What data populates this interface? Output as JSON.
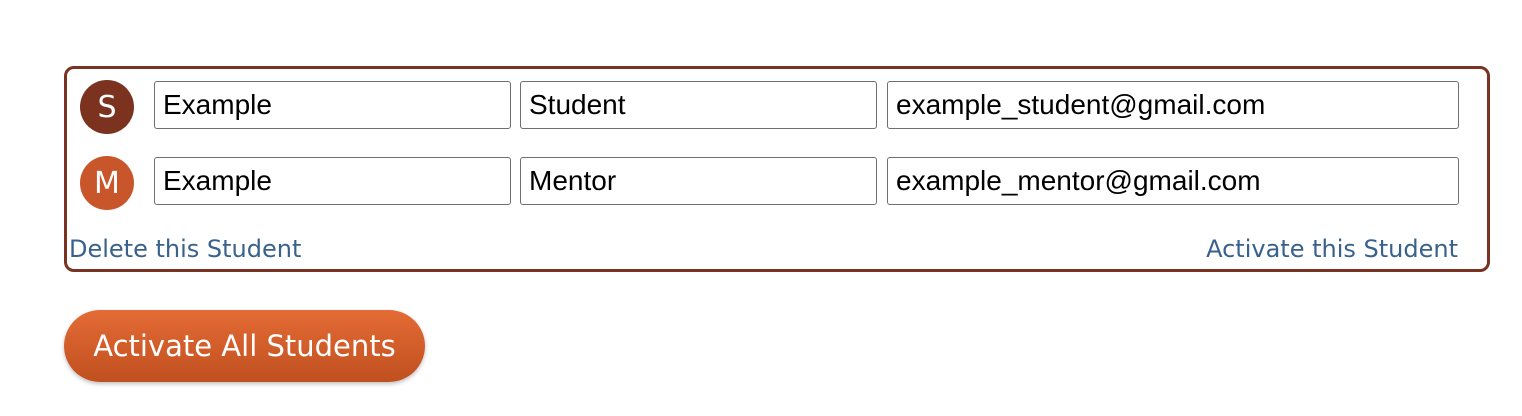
{
  "student_card": {
    "members": [
      {
        "role": "student",
        "avatar_letter": "S",
        "avatar_color": "#7b3320",
        "first_name": "Example",
        "last_name": "Student",
        "email": "example_student@gmail.com"
      },
      {
        "role": "mentor",
        "avatar_letter": "M",
        "avatar_color": "#c8562a",
        "first_name": "Example",
        "last_name": "Mentor",
        "email": "example_mentor@gmail.com"
      }
    ],
    "delete_link_label": "Delete this Student",
    "activate_link_label": "Activate this Student",
    "border_color": "#7a3322",
    "link_color": "#38618c"
  },
  "activate_all_button": {
    "label": "Activate All Students",
    "color": "#d85e2a"
  }
}
